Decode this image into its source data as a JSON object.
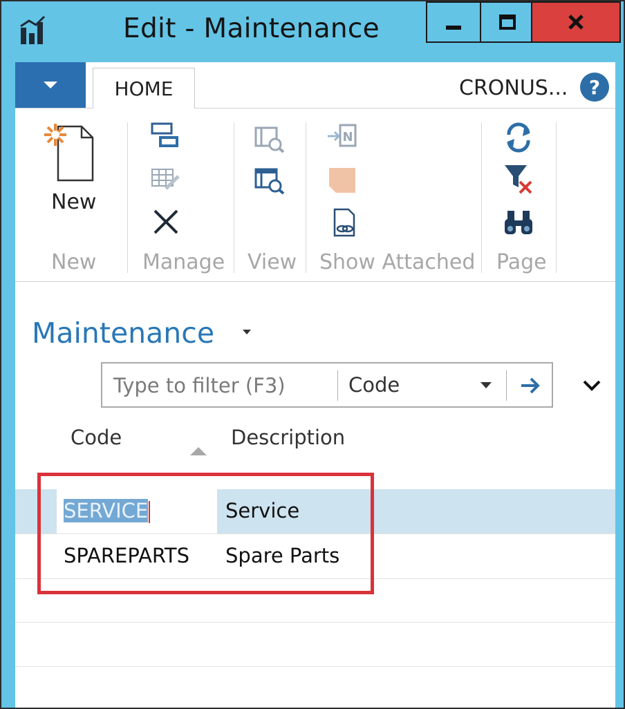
{
  "window": {
    "title": "Edit - Maintenance",
    "buttons": [
      "minimize",
      "maximize",
      "close"
    ],
    "accent_color": "#63c4e6",
    "close_color": "#d9403e"
  },
  "ribbon": {
    "tabs": [
      {
        "label": "HOME",
        "active": true
      }
    ],
    "company": "CRONUS...",
    "groups": [
      {
        "label": "New",
        "actions": [
          {
            "label": "New",
            "icon": "new-document-icon"
          }
        ]
      },
      {
        "label": "Manage",
        "actions": [
          {
            "icon": "edit-list-icon"
          },
          {
            "icon": "edit-icon"
          },
          {
            "icon": "delete-icon"
          }
        ]
      },
      {
        "label": "View",
        "actions": [
          {
            "icon": "view-icon"
          },
          {
            "icon": "view-list-icon"
          }
        ]
      },
      {
        "label": "Show Attached",
        "actions": [
          {
            "icon": "onenote-icon"
          },
          {
            "icon": "notes-icon"
          },
          {
            "icon": "links-icon"
          }
        ]
      },
      {
        "label": "Page",
        "actions": [
          {
            "icon": "refresh-icon"
          },
          {
            "icon": "clear-filter-icon"
          },
          {
            "icon": "find-icon"
          }
        ]
      }
    ]
  },
  "page": {
    "title": "Maintenance",
    "filter": {
      "placeholder": "Type to filter (F3)",
      "field": "Code"
    },
    "columns": [
      "Code",
      "Description"
    ],
    "rows": [
      {
        "code": "SERVICE",
        "description": "Service",
        "selected": true
      },
      {
        "code": "SPAREPARTS",
        "description": "Spare Parts",
        "selected": false
      }
    ]
  }
}
